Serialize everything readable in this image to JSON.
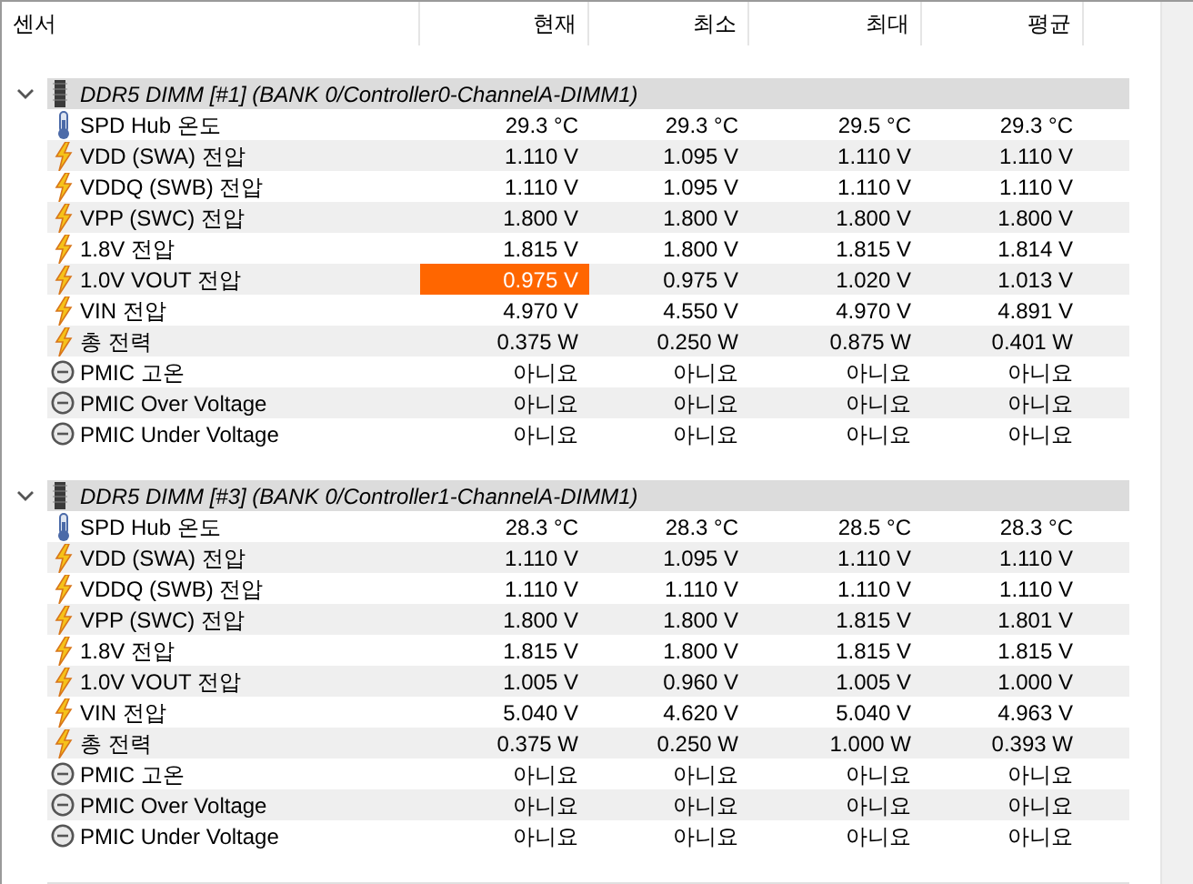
{
  "columns": [
    "센서",
    "현재",
    "최소",
    "최대",
    "평균"
  ],
  "groups": [
    {
      "title": "DDR5 DIMM [#1] (BANK 0/Controller0-ChannelA-DIMM1)",
      "expanded": true,
      "rows": [
        {
          "kind": "temp",
          "label": "SPD Hub 온도",
          "values": [
            "29.3 °C",
            "29.3 °C",
            "29.5 °C",
            "29.3 °C"
          ],
          "alert": false
        },
        {
          "kind": "volt",
          "label": "VDD (SWA) 전압",
          "values": [
            "1.110 V",
            "1.095 V",
            "1.110 V",
            "1.110 V"
          ],
          "alert": false
        },
        {
          "kind": "volt",
          "label": "VDDQ (SWB) 전압",
          "values": [
            "1.110 V",
            "1.095 V",
            "1.110 V",
            "1.110 V"
          ],
          "alert": false
        },
        {
          "kind": "volt",
          "label": "VPP (SWC) 전압",
          "values": [
            "1.800 V",
            "1.800 V",
            "1.800 V",
            "1.800 V"
          ],
          "alert": false
        },
        {
          "kind": "volt",
          "label": "1.8V 전압",
          "values": [
            "1.815 V",
            "1.800 V",
            "1.815 V",
            "1.814 V"
          ],
          "alert": false
        },
        {
          "kind": "volt",
          "label": "1.0V VOUT 전압",
          "values": [
            "0.975 V",
            "0.975 V",
            "1.020 V",
            "1.013 V"
          ],
          "alert": true
        },
        {
          "kind": "volt",
          "label": "VIN 전압",
          "values": [
            "4.970 V",
            "4.550 V",
            "4.970 V",
            "4.891 V"
          ],
          "alert": false
        },
        {
          "kind": "volt",
          "label": "총 전력",
          "values": [
            "0.375 W",
            "0.250 W",
            "0.875 W",
            "0.401 W"
          ],
          "alert": false
        },
        {
          "kind": "status",
          "label": "PMIC 고온",
          "values": [
            "아니요",
            "아니요",
            "아니요",
            "아니요"
          ],
          "alert": false
        },
        {
          "kind": "status",
          "label": "PMIC Over Voltage",
          "values": [
            "아니요",
            "아니요",
            "아니요",
            "아니요"
          ],
          "alert": false
        },
        {
          "kind": "status",
          "label": "PMIC Under Voltage",
          "values": [
            "아니요",
            "아니요",
            "아니요",
            "아니요"
          ],
          "alert": false
        }
      ]
    },
    {
      "title": "DDR5 DIMM [#3] (BANK 0/Controller1-ChannelA-DIMM1)",
      "expanded": true,
      "rows": [
        {
          "kind": "temp",
          "label": "SPD Hub 온도",
          "values": [
            "28.3 °C",
            "28.3 °C",
            "28.5 °C",
            "28.3 °C"
          ],
          "alert": false
        },
        {
          "kind": "volt",
          "label": "VDD (SWA) 전압",
          "values": [
            "1.110 V",
            "1.095 V",
            "1.110 V",
            "1.110 V"
          ],
          "alert": false
        },
        {
          "kind": "volt",
          "label": "VDDQ (SWB) 전압",
          "values": [
            "1.110 V",
            "1.110 V",
            "1.110 V",
            "1.110 V"
          ],
          "alert": false
        },
        {
          "kind": "volt",
          "label": "VPP (SWC) 전압",
          "values": [
            "1.800 V",
            "1.800 V",
            "1.815 V",
            "1.801 V"
          ],
          "alert": false
        },
        {
          "kind": "volt",
          "label": "1.8V 전압",
          "values": [
            "1.815 V",
            "1.800 V",
            "1.815 V",
            "1.815 V"
          ],
          "alert": false
        },
        {
          "kind": "volt",
          "label": "1.0V VOUT 전압",
          "values": [
            "1.005 V",
            "0.960 V",
            "1.005 V",
            "1.000 V"
          ],
          "alert": false
        },
        {
          "kind": "volt",
          "label": "VIN 전압",
          "values": [
            "5.040 V",
            "4.620 V",
            "5.040 V",
            "4.963 V"
          ],
          "alert": false
        },
        {
          "kind": "volt",
          "label": "총 전력",
          "values": [
            "0.375 W",
            "0.250 W",
            "1.000 W",
            "0.393 W"
          ],
          "alert": false
        },
        {
          "kind": "status",
          "label": "PMIC 고온",
          "values": [
            "아니요",
            "아니요",
            "아니요",
            "아니요"
          ],
          "alert": false
        },
        {
          "kind": "status",
          "label": "PMIC Over Voltage",
          "values": [
            "아니요",
            "아니요",
            "아니요",
            "아니요"
          ],
          "alert": false
        },
        {
          "kind": "status",
          "label": "PMIC Under Voltage",
          "values": [
            "아니요",
            "아니요",
            "아니요",
            "아니요"
          ],
          "alert": false
        }
      ]
    }
  ]
}
